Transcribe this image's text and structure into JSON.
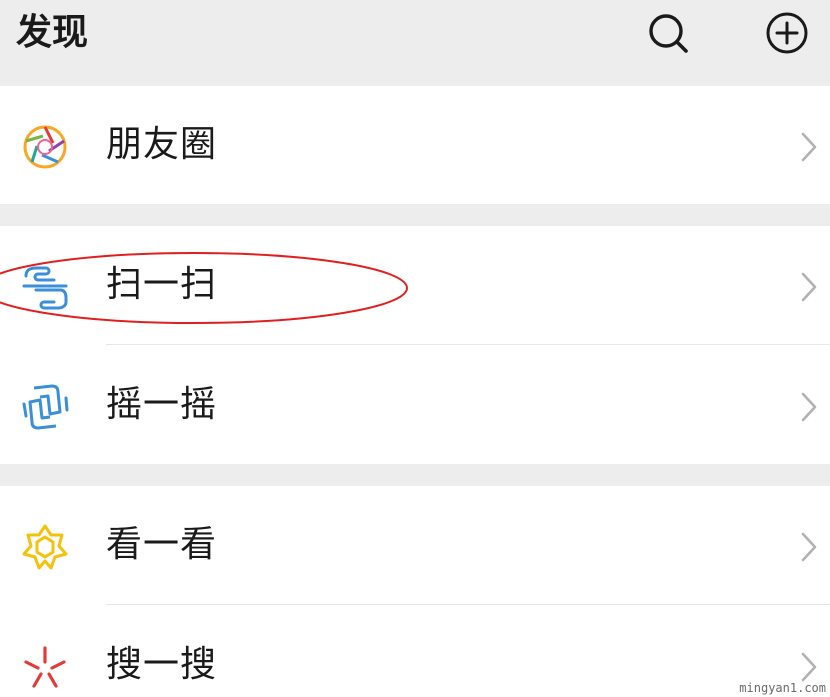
{
  "header": {
    "title": "发现",
    "search_icon": "search-icon",
    "add_icon": "plus-circle-icon"
  },
  "items": [
    {
      "label": "朋友圈",
      "icon": "moments-aperture-icon",
      "color": "#f9a825"
    },
    {
      "label": "扫一扫",
      "icon": "scan-icon",
      "color": "#3a8fd8"
    },
    {
      "label": "摇一摇",
      "icon": "shake-phone-icon",
      "color": "#3a8fd8"
    },
    {
      "label": "看一看",
      "icon": "top-stories-icon",
      "color": "#f4c20d"
    },
    {
      "label": "搜一搜",
      "icon": "search-burst-icon",
      "color": "#e53935"
    }
  ],
  "colors": {
    "header_bg": "#ededed",
    "row_bg": "#ffffff",
    "text": "#1a1a1a",
    "chevron": "#b2b2b2",
    "annotation": "#e02020"
  },
  "watermark": "mingyan1.com"
}
